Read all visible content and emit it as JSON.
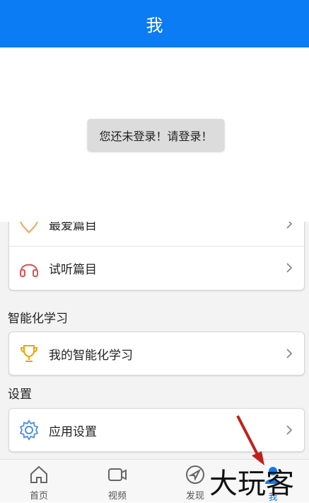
{
  "header": {
    "title": "我"
  },
  "toast": {
    "text": "您还未登录！请登录！"
  },
  "lists": {
    "favorite_label": "最爱篇目",
    "trial_label": "试听篇目"
  },
  "smart": {
    "section_title": "智能化学习",
    "item_label": "我的智能化学习"
  },
  "settings": {
    "section_title": "设置",
    "item_label": "应用设置"
  },
  "tabs": [
    {
      "label": "首页",
      "icon": "home-icon"
    },
    {
      "label": "视频",
      "icon": "video-icon"
    },
    {
      "label": "发现",
      "icon": "discover-icon"
    },
    {
      "label": "我",
      "icon": "profile-icon"
    }
  ],
  "watermark": {
    "text": "大玩客"
  },
  "colors": {
    "accent": "#0b7cf3",
    "heart": "#f2a65a",
    "headphones": "#e05050",
    "trophy": "#f2a400",
    "gear": "#4a90e2"
  }
}
